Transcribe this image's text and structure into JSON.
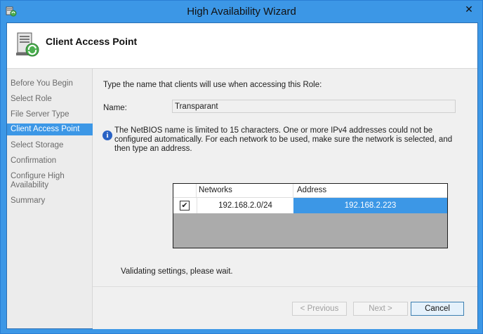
{
  "window": {
    "title": "High Availability Wizard",
    "close_glyph": "✕"
  },
  "header": {
    "title": "Client Access Point"
  },
  "nav": {
    "items": [
      {
        "label": "Before You Begin"
      },
      {
        "label": "Select Role"
      },
      {
        "label": "File Server Type"
      },
      {
        "label": "Client Access Point",
        "active": true
      },
      {
        "label": "Select Storage"
      },
      {
        "label": "Confirmation"
      },
      {
        "label": "Configure High Availability"
      },
      {
        "label": "Summary"
      }
    ]
  },
  "main": {
    "instruction": "Type the name that clients will use when accessing this Role:",
    "name_label": "Name:",
    "name_value": "Transparant",
    "info_text": "The NetBIOS name is limited to 15 characters.  One or more IPv4 addresses could not be configured automatically.  For each network to be used, make sure the network is selected, and then type an address.",
    "table": {
      "headers": [
        "Networks",
        "Address"
      ],
      "rows": [
        {
          "checked": true,
          "network": "192.168.2.0/24",
          "address": "192.168.2.223"
        }
      ]
    },
    "status": "Validating settings, please wait."
  },
  "footer": {
    "previous_label": "< Previous",
    "next_label": "Next >",
    "cancel_label": "Cancel"
  },
  "colors": {
    "accent": "#3c97e6"
  }
}
